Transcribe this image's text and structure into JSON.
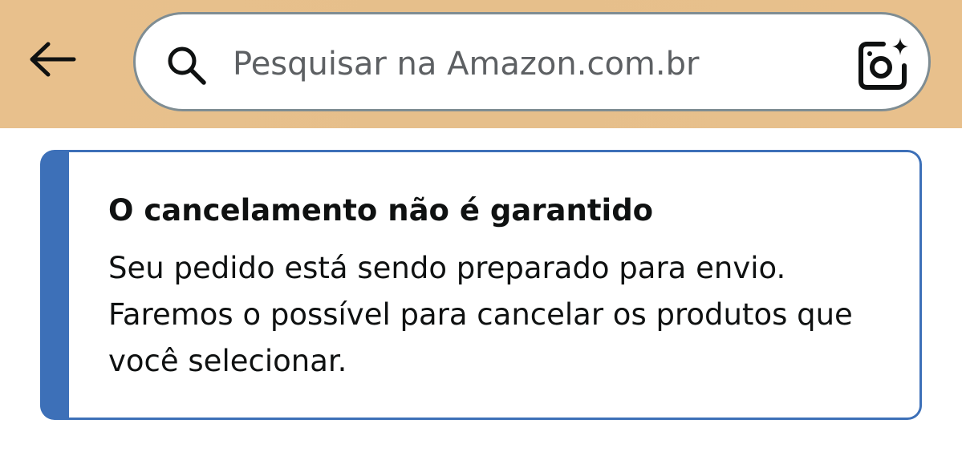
{
  "header": {
    "back_icon": "arrow-left-icon",
    "search": {
      "placeholder": "Pesquisar na Amazon.com.br",
      "value": "",
      "search_icon": "magnifier-icon",
      "camera_icon": "camera-sparkle-icon"
    },
    "background_color": "#e8c08c"
  },
  "alert": {
    "title": "O cancelamento não é garantido",
    "message": "Seu pedido está sendo preparado para envio. Faremos o possível para cancelar os produtos que você selecionar.",
    "accent_color": "#3d70b8"
  }
}
